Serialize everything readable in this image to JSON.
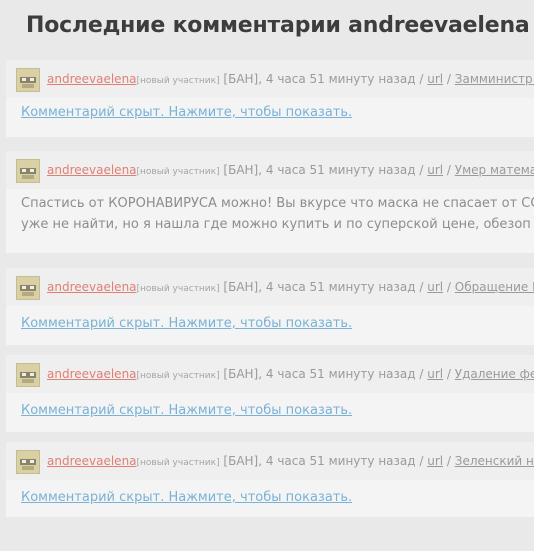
{
  "page": {
    "title": "Последние комментарии andreevaelena"
  },
  "comments": [
    {
      "author": "andreevaelena",
      "role": "[новый участник]",
      "status": " [БАН], 4 часа 51 минуту назад / ",
      "url_label": "url",
      "separator": " / ",
      "topic": "Замминистр думского..",
      "hidden_text": "Комментарий скрыт. Нажмите, чтобы показать."
    },
    {
      "author": "andreevaelena",
      "role": "[новый участник]",
      "status": " [БАН], 4 часа 51 минуту назад / ",
      "url_label": "url",
      "separator": " / ",
      "topic": "Умер математик Се",
      "body_lines": [
        "Спастись от КОРОНАВИРУСА можно! Вы вкурсе что маска не спасает от CO",
        "уже не найти, но я нашла где можно купить и по суперской цене, обезоп"
      ]
    },
    {
      "author": "andreevaelena",
      "role": "[новый участник]",
      "status": " [БАН], 4 часа 51 минуту назад / ",
      "url_label": "url",
      "separator": " / ",
      "topic": "Обращение Путина",
      "hidden_text": "Комментарий скрыт. Нажмите, чтобы показать."
    },
    {
      "author": "andreevaelena",
      "role": "[новый участник]",
      "status": " [БАН], 4 часа 51 минуту назад / ",
      "url_label": "url",
      "separator": " / ",
      "topic": "Удаление фейков и",
      "hidden_text": "Комментарий скрыт. Нажмите, чтобы показать."
    },
    {
      "author": "andreevaelena",
      "role": "[новый участник]",
      "status": " [БАН], 4 часа 51 минуту назад / ",
      "url_label": "url",
      "separator": " / ",
      "topic": "Зеленский не прин",
      "hidden_text": "Комментарий скрыт. Нажмите, чтобы показать."
    }
  ]
}
